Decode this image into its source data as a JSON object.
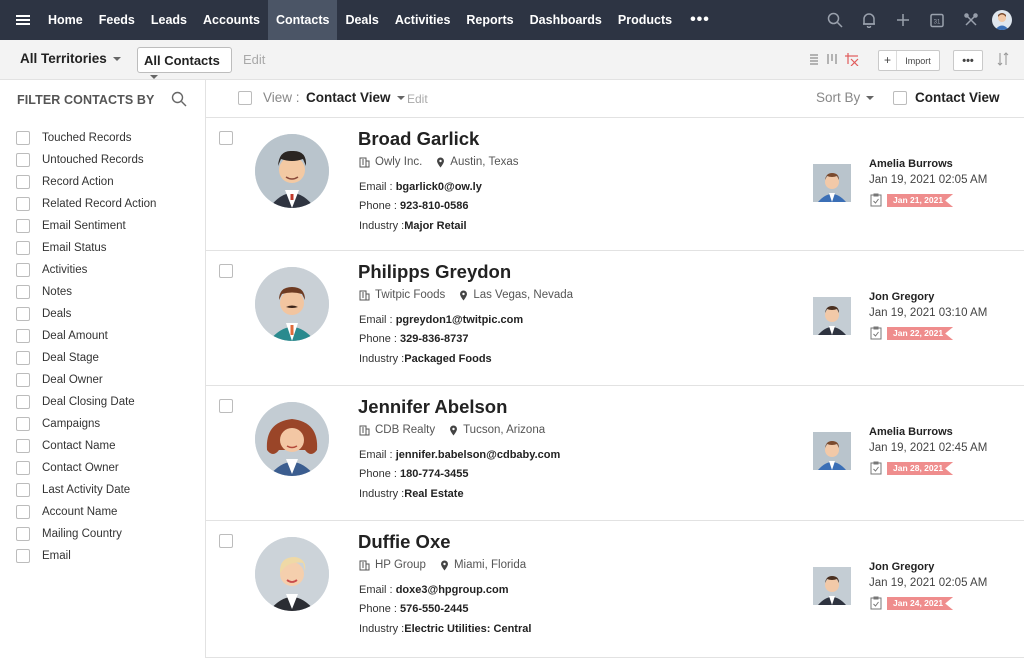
{
  "nav": {
    "items": [
      {
        "label": "Home",
        "active": false
      },
      {
        "label": "Feeds",
        "active": false
      },
      {
        "label": "Leads",
        "active": false
      },
      {
        "label": "Accounts",
        "active": false
      },
      {
        "label": "Contacts",
        "active": true
      },
      {
        "label": "Deals",
        "active": false
      },
      {
        "label": "Activities",
        "active": false
      },
      {
        "label": "Reports",
        "active": false
      },
      {
        "label": "Dashboards",
        "active": false
      },
      {
        "label": "Products",
        "active": false
      }
    ],
    "more": "•••",
    "icons": [
      "search-icon",
      "bell-icon",
      "plus-icon",
      "calendar-icon",
      "tools-icon",
      "user-avatar"
    ],
    "calendar_day": "31"
  },
  "toolbar": {
    "territory": "All Territories",
    "view_select": "All Contacts",
    "edit": "Edit",
    "add": "+",
    "import": "Import",
    "more": "•••"
  },
  "sidebar": {
    "title": "FILTER CONTACTS BY",
    "filters": [
      "Touched Records",
      "Untouched Records",
      "Record Action",
      "Related Record Action",
      "Email Sentiment",
      "Email Status",
      "Activities",
      "Notes",
      "Deals",
      "Deal Amount",
      "Deal Stage",
      "Deal Owner",
      "Deal Closing Date",
      "Campaigns",
      "Contact Name",
      "Contact Owner",
      "Last Activity Date",
      "Account Name",
      "Mailing Country",
      "Email"
    ]
  },
  "list_header": {
    "view_label": "View :",
    "view_value": "Contact View",
    "edit": "Edit",
    "sort_by": "Sort By",
    "contact_view": "Contact View"
  },
  "labels": {
    "email": "Email :",
    "phone": "Phone :",
    "industry": "Industry :"
  },
  "records": [
    {
      "name": "Broad Garlick",
      "company": "Owly Inc.",
      "location": "Austin, Texas",
      "email": "bgarlick0@ow.ly",
      "phone": "923-810-0586",
      "industry": "Major Retail",
      "owner": "Amelia Burrows",
      "date": "Jan 19, 2021 02:05 AM",
      "due": "Jan 21, 2021"
    },
    {
      "name": "Philipps Greydon",
      "company": "Twitpic Foods",
      "location": "Las Vegas, Nevada",
      "email": "pgreydon1@twitpic.com",
      "phone": "329-836-8737",
      "industry": "Packaged Foods",
      "owner": "Jon Gregory",
      "date": "Jan 19, 2021 03:10 AM",
      "due": "Jan 22, 2021"
    },
    {
      "name": "Jennifer Abelson",
      "company": "CDB Realty",
      "location": "Tucson, Arizona",
      "email": "jennifer.babelson@cdbaby.com",
      "phone": "180-774-3455",
      "industry": "Real Estate",
      "owner": "Amelia Burrows",
      "date": "Jan 19, 2021 02:45 AM",
      "due": "Jan 28, 2021"
    },
    {
      "name": "Duffie Oxe",
      "company": "HP Group",
      "location": "Miami, Florida",
      "email": "doxe3@hpgroup.com",
      "phone": "576-550-2445",
      "industry": "Electric Utilities: Central",
      "owner": "Jon Gregory",
      "date": "Jan 19, 2021 02:05 AM",
      "due": "Jan 24, 2021"
    }
  ],
  "colors": {
    "nav_bg": "#2d3443",
    "nav_active": "#4b5566",
    "tag": "#ef8d8d",
    "toolbar_bg": "#f3f3f3"
  }
}
